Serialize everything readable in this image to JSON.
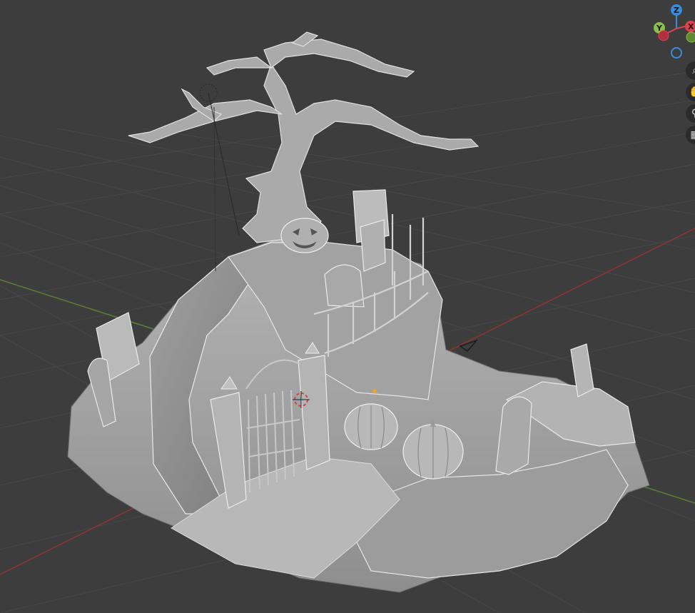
{
  "gizmo": {
    "axis_z": "Z",
    "axis_y": "Y",
    "axis_x": "X",
    "colors": {
      "x": "#e0404f",
      "y": "#8bc04a",
      "z": "#3b8bdc"
    }
  },
  "nav_buttons": [
    {
      "icon": "zoom-icon",
      "glyph": "⌕"
    },
    {
      "icon": "hand-pan-icon",
      "glyph": "✋"
    },
    {
      "icon": "camera-icon",
      "glyph": "⚲"
    },
    {
      "icon": "grid-view-icon",
      "glyph": "▦"
    }
  ],
  "viewport": {
    "background": "#3d3d3d",
    "grid_color": "#4a4a4a",
    "x_axis_color": "#9b3b3b",
    "y_axis_color": "#6a8a3a",
    "model_color": "#a9a9a9"
  }
}
